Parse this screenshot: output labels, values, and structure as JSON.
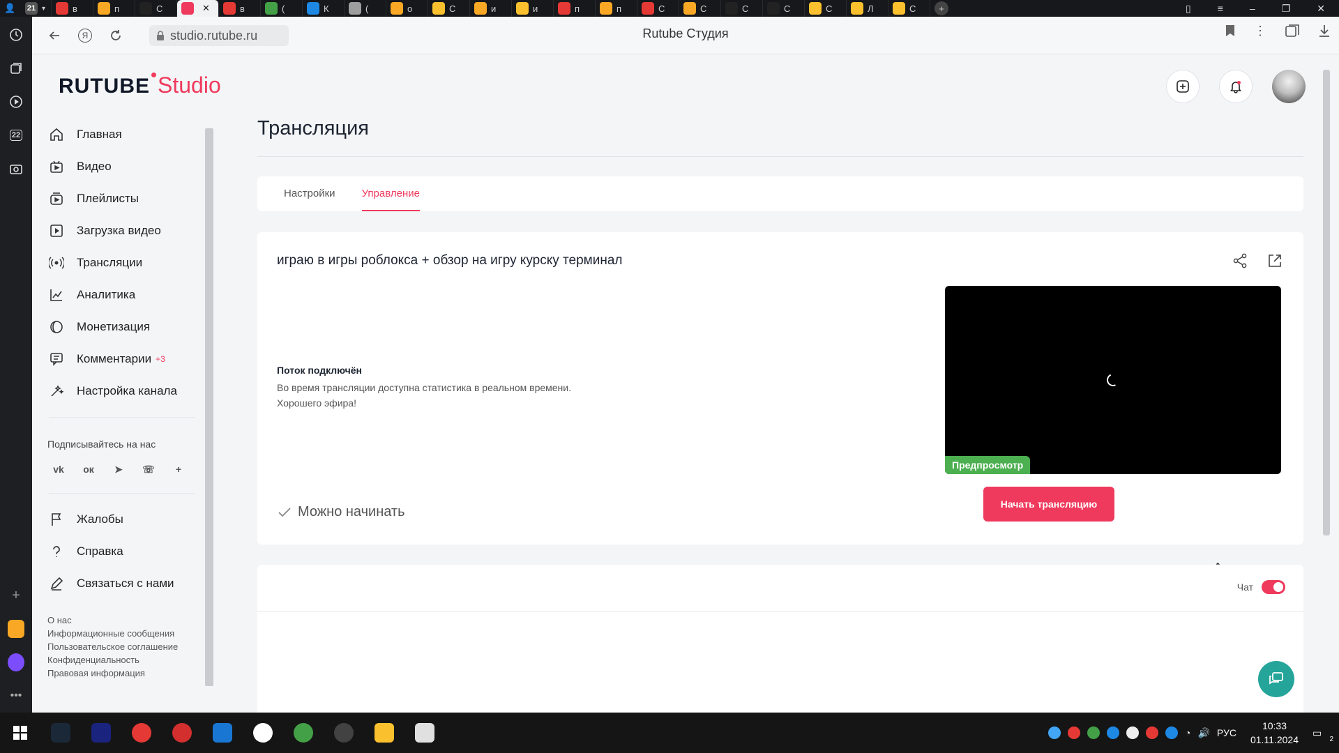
{
  "browser": {
    "tab_count": "21",
    "tabs": [
      {
        "icon": "yandex-icon",
        "label": "в",
        "color": "#e53935"
      },
      {
        "icon": "mail-icon",
        "label": "п",
        "color": "#f9a825"
      },
      {
        "icon": "rutube-icon",
        "label": "С",
        "color": "#222222"
      },
      {
        "icon": "rutube-studio-icon",
        "label": "",
        "color": "#ef3a5d",
        "active": true
      },
      {
        "icon": "yandex-icon",
        "label": "в",
        "color": "#e53935"
      },
      {
        "icon": "whatsapp-icon",
        "label": "(",
        "color": "#43a047"
      },
      {
        "icon": "puzzle-icon",
        "label": "К",
        "color": "#1e88e5"
      },
      {
        "icon": "app-icon",
        "label": "(",
        "color": "#9e9e9e"
      },
      {
        "icon": "mail-icon",
        "label": "о",
        "color": "#f9a825"
      },
      {
        "icon": "play-icon",
        "label": "С",
        "color": "#fbc02d"
      },
      {
        "icon": "mail-icon",
        "label": "и",
        "color": "#f9a825"
      },
      {
        "icon": "play-icon",
        "label": "и",
        "color": "#fbc02d"
      },
      {
        "icon": "yandex-icon",
        "label": "п",
        "color": "#e53935"
      },
      {
        "icon": "mail-icon",
        "label": "п",
        "color": "#f9a825"
      },
      {
        "icon": "yandex-icon",
        "label": "С",
        "color": "#e53935"
      },
      {
        "icon": "mail-icon",
        "label": "С",
        "color": "#f9a825"
      },
      {
        "icon": "rutube-icon",
        "label": "С",
        "color": "#222222"
      },
      {
        "icon": "rutube-icon",
        "label": "С",
        "color": "#222222"
      },
      {
        "icon": "play-icon",
        "label": "С",
        "color": "#fbc02d"
      },
      {
        "icon": "play-icon",
        "label": "Л",
        "color": "#fbc02d"
      },
      {
        "icon": "play-icon",
        "label": "С",
        "color": "#fbc02d"
      }
    ],
    "url": "studio.rutube.ru",
    "page_title": "Rutube Студия",
    "rail_badge": "22"
  },
  "logo": {
    "rutube": "RUTUBE",
    "studio": "Studio"
  },
  "sidebar": {
    "items": [
      {
        "label": "Главная",
        "icon": "home-icon"
      },
      {
        "label": "Видео",
        "icon": "video-icon"
      },
      {
        "label": "Плейлисты",
        "icon": "playlist-icon"
      },
      {
        "label": "Загрузка видео",
        "icon": "upload-icon"
      },
      {
        "label": "Трансляции",
        "icon": "broadcast-icon"
      },
      {
        "label": "Аналитика",
        "icon": "analytics-icon"
      },
      {
        "label": "Монетизация",
        "icon": "monetization-icon"
      },
      {
        "label": "Комментарии",
        "icon": "comments-icon",
        "badge": "+3"
      },
      {
        "label": "Настройка канала",
        "icon": "channel-settings-icon"
      }
    ],
    "follow_title": "Подписывайтесь на нас",
    "socials": [
      "vk-icon",
      "ok-icon",
      "telegram-icon",
      "viber-icon",
      "plus-icon"
    ],
    "social_glyphs": [
      "vk",
      "ок",
      "➤",
      "☏",
      "+"
    ],
    "bottom_items": [
      {
        "label": "Жалобы",
        "icon": "flag-icon"
      },
      {
        "label": "Справка",
        "icon": "help-icon"
      },
      {
        "label": "Связаться с нами",
        "icon": "contact-icon"
      }
    ],
    "footer_links": [
      "О нас",
      "Информационные сообщения",
      "Пользовательское соглашение",
      "Конфиденциальность",
      "Правовая информация"
    ]
  },
  "main": {
    "title": "Трансляция",
    "tabs": [
      {
        "label": "Настройки",
        "active": false
      },
      {
        "label": "Управление",
        "active": true
      }
    ],
    "stream": {
      "title": "играю в игры роблокса + обзор на игру курску терминал",
      "status_heading": "Поток подключён",
      "status_line1": "Во время трансляции доступна статистика в реальном времени.",
      "status_line2": "Хорошего эфира!",
      "preview_badge": "Предпросмотр",
      "ready_text": "Можно начинать",
      "start_button": "Начать трансляцию"
    },
    "chat": {
      "label": "Чат",
      "enabled": true
    }
  },
  "taskbar": {
    "apps": [
      {
        "icon": "steam-icon",
        "color": "#1b2838"
      },
      {
        "icon": "app-icon",
        "color": "#1a237e"
      },
      {
        "icon": "yandex-icon",
        "color": "#e53935"
      },
      {
        "icon": "opera-icon",
        "color": "#d32f2f"
      },
      {
        "icon": "explorer-icon",
        "color": "#1976d2"
      },
      {
        "icon": "yandex-browser-icon",
        "color": "#ffffff"
      },
      {
        "icon": "utorrent-icon",
        "color": "#43a047"
      },
      {
        "icon": "obs-icon",
        "color": "#424242"
      },
      {
        "icon": "folder-icon",
        "color": "#fbc02d"
      },
      {
        "icon": "app-icon",
        "color": "#e0e0e0"
      }
    ],
    "tray_colors": [
      "#42a5f5",
      "#e53935",
      "#43a047",
      "#1e88e5",
      "#eeeeee",
      "#e53935",
      "#1e88e5"
    ],
    "language": "РУС",
    "time": "10:33",
    "date": "01.11.2024",
    "notifications": "2"
  },
  "colors": {
    "accent": "#ef3a5d",
    "preview_badge": "#4caf50",
    "help_button": "#25a59a"
  }
}
